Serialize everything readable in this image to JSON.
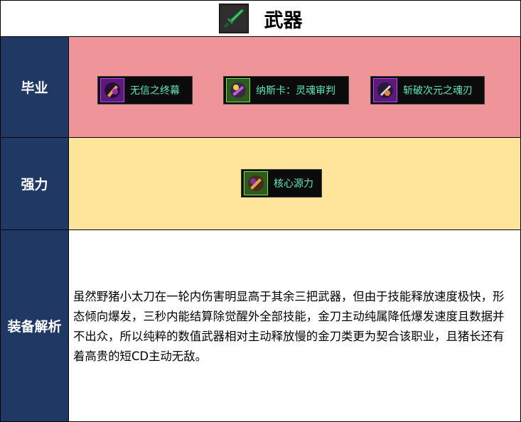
{
  "header": {
    "title": "武器",
    "icon": "sword-icon"
  },
  "rows": [
    {
      "label": "毕业",
      "items": [
        {
          "name": "无信之终幕",
          "icon": "purple-weapon-icon"
        },
        {
          "name": "纳斯卡：灵魂审判",
          "icon": "green-weapon-icon"
        },
        {
          "name": "斩破次元之魂刃",
          "icon": "purple-weapon-icon"
        }
      ]
    },
    {
      "label": "强力",
      "items": [
        {
          "name": "核心源力",
          "icon": "green-weapon-icon"
        }
      ]
    },
    {
      "label": "装备解析",
      "text": "虽然野猪小太刀在一轮内伤害明显高于其余三把武器，但由于技能释放速度极快，形态倾向爆发，三秒内能结算除觉醒外全部技能，金刀主动纯属降低爆发速度且数据并不出众，所以纯粹的数值武器相对主动释放慢的金刀类更为契合该职业，且猪长还有着高贵的短CD主动无敌。"
    }
  ],
  "colors": {
    "label_bg": "#1f3864",
    "row1_bg": "#ef9499",
    "row2_bg": "#ffe49c",
    "item_text": "#5fe8c0"
  }
}
